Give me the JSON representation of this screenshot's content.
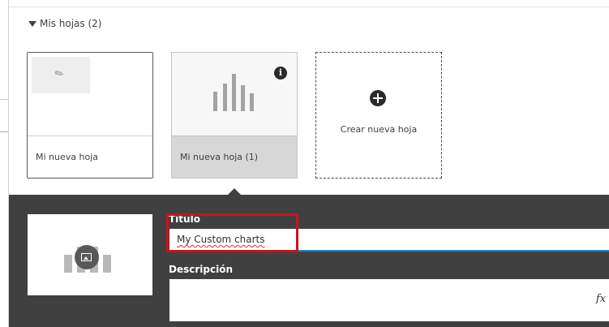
{
  "section": {
    "title": "Mis hojas (2)"
  },
  "sheets": [
    {
      "title": "Mi nueva hoja"
    },
    {
      "title": "Mi nueva hoja (1)"
    }
  ],
  "create_sheet": {
    "label": "Crear nueva hoja"
  },
  "details_panel": {
    "title_label": "Título",
    "title_value": "My Custom charts",
    "description_label": "Descripción",
    "description_value": "",
    "formula_icon_text": "fx",
    "info_icon_text": "i"
  },
  "colors": {
    "panel_bg": "#404040",
    "input_focus": "#2f80c0",
    "highlight_box": "#c8141e"
  },
  "icons": [
    "caret-down-icon",
    "pin-icon",
    "bar-chart-icon",
    "info-icon",
    "plus-circle-icon",
    "image-icon",
    "fx-icon"
  ]
}
